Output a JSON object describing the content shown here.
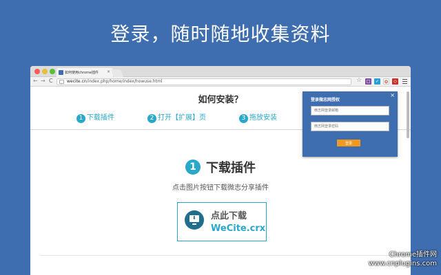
{
  "headline": "登录，随时随地收集资料",
  "browser": {
    "tab_title": "如何使用chrome插件",
    "tab_close": "×",
    "url_host": "wecite.cn",
    "url_path": "/index.php/home/index/howuse.html",
    "nav_back": "←",
    "nav_forward": "→",
    "nav_reload": "C",
    "star": "☆",
    "ext_labels": [
      "□",
      "✓",
      "O",
      "◇"
    ]
  },
  "page": {
    "title": "如何安装？",
    "steps": [
      {
        "num": "1",
        "label": "下载插件"
      },
      {
        "num": "2",
        "label": "打开【扩展】页"
      },
      {
        "num": "3",
        "label": "拖放安装"
      }
    ],
    "section": {
      "num": "1",
      "title": "下载插件",
      "subtitle": "点击图片按钮下载微志分享插件"
    },
    "download": {
      "label": "点此下载",
      "filename": "WeCite.crx",
      "arrow": "⬇"
    }
  },
  "login": {
    "title": "登录微志网授权",
    "close": "×",
    "username_placeholder": "微志网登录邮箱",
    "password_placeholder": "微志网登录密码",
    "submit": "登录"
  },
  "watermark": {
    "line1": "Chrome插件网",
    "line2": "www.cnplugins.com"
  },
  "colors": {
    "background": "#3e6db0",
    "accent": "#2aa8c9",
    "button": "#f29a1f"
  }
}
